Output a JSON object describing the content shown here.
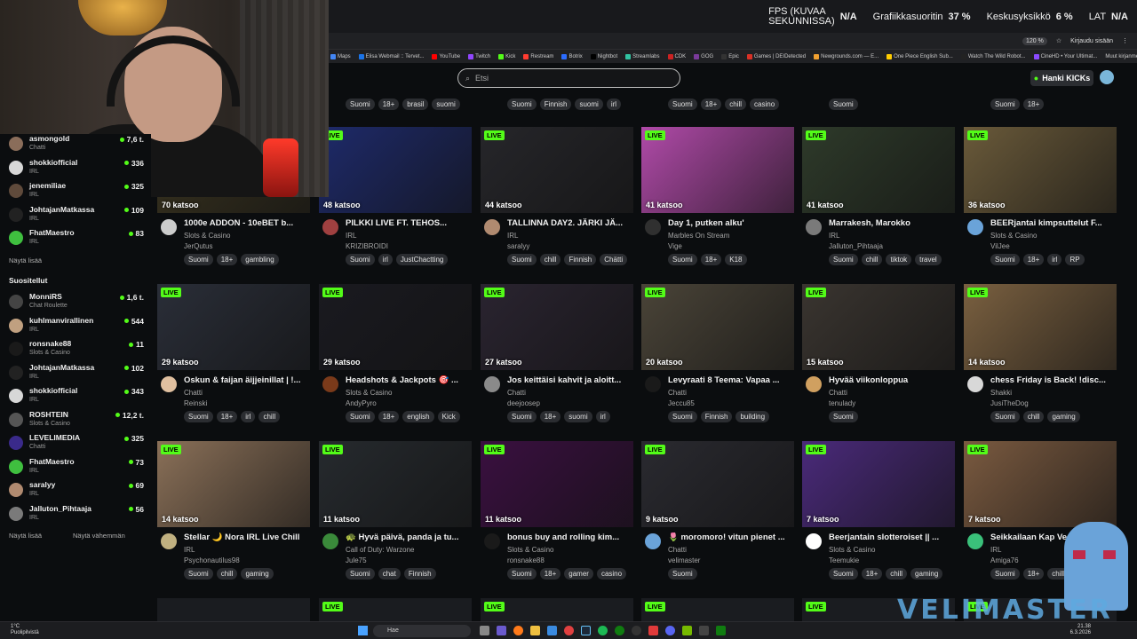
{
  "overlay": {
    "fps_label_line1": "FPS (KUVAA",
    "fps_label_line2": "SEKUNNISSA)",
    "fps_value": "N/A",
    "gpu_label": "Grafiikkasuoritin",
    "gpu_value": "37 %",
    "cpu_label": "Keskusyksikkö",
    "cpu_value": "6 %",
    "lat_label": "LAT",
    "lat_value": "N/A"
  },
  "browser": {
    "zoom": "120 %",
    "signin": "Kirjaudu sisään",
    "bookmarks": [
      "Maps",
      "Elisa Webmail :: Tervet...",
      "YouTube",
      "Twitch",
      "Kick",
      "Restream",
      "Botrix",
      "Nightbot",
      "Streamlabs",
      "CDK",
      "GOG",
      "Epic",
      "Games | DEIDetected",
      "Newgrounds.com — E...",
      "One Piece English Sub...",
      "Watch The Wild Robot...",
      "CineHD • Your Ultimat..."
    ],
    "other_bookmarks": "Muut kirjanmerkit"
  },
  "header": {
    "search_placeholder": "Etsi",
    "kick_button": "Hanki KICKs"
  },
  "sidebar": {
    "following": [
      {
        "name": "asmongold",
        "cat": "Chatti",
        "viewers": "7,6 t.",
        "color": "#8a6d5a"
      },
      {
        "name": "shokkiofficial",
        "cat": "IRL",
        "viewers": "336",
        "color": "#d7d7d7"
      },
      {
        "name": "jenemiliae",
        "cat": "IRL",
        "viewers": "325",
        "color": "#5f4a3b"
      },
      {
        "name": "JohtajanMatkassa",
        "cat": "IRL",
        "viewers": "109",
        "color": "#222222"
      },
      {
        "name": "FhatMaestro",
        "cat": "IRL",
        "viewers": "83",
        "color": "#3fbf3f"
      }
    ],
    "show_more": "Näytä lisää",
    "recommended_title": "Suositellut",
    "recommended": [
      {
        "name": "MonniRS",
        "cat": "Chat Roulette",
        "viewers": "1,6 t.",
        "color": "#444444"
      },
      {
        "name": "kuhlmanvirallinen",
        "cat": "IRL",
        "viewers": "544",
        "color": "#c0a080"
      },
      {
        "name": "ronsnake88",
        "cat": "Slots & Casino",
        "viewers": "11",
        "color": "#1a1a1a"
      },
      {
        "name": "JohtajanMatkassa",
        "cat": "IRL",
        "viewers": "102",
        "color": "#222222"
      },
      {
        "name": "shokkiofficial",
        "cat": "IRL",
        "viewers": "343",
        "color": "#d7d7d7"
      },
      {
        "name": "ROSHTEIN",
        "cat": "Slots & Casino",
        "viewers": "12,2 t.",
        "color": "#555555"
      },
      {
        "name": "LEVELIMEDIA",
        "cat": "Chatti",
        "viewers": "325",
        "color": "#3a2a8a"
      },
      {
        "name": "FhatMaestro",
        "cat": "IRL",
        "viewers": "73",
        "color": "#3fbf3f"
      },
      {
        "name": "saralyy",
        "cat": "IRL",
        "viewers": "69",
        "color": "#b08a70"
      },
      {
        "name": "Jalluton_Pihtaaja",
        "cat": "IRL",
        "viewers": "56",
        "color": "#7a7a7a"
      }
    ],
    "show_more2": "Näytä lisää",
    "show_less": "Näytä vähemmän"
  },
  "top_tags": [
    [
      "Suomi",
      "18+",
      "brasil",
      "suomi"
    ],
    [
      "Suomi",
      "Finnish",
      "suomi",
      "irl"
    ],
    [
      "Suomi",
      "18+",
      "chill",
      "casino"
    ],
    [
      "Suomi"
    ],
    [
      "Suomi",
      "18+"
    ]
  ],
  "live_label": "LIVE",
  "rows": [
    [
      {
        "viewers": "70 katsoo",
        "title": "1000e ADDON - 10eBET b...",
        "cat": "Slots & Casino",
        "user": "JerQutus",
        "tags": [
          "Suomi",
          "18+",
          "gambling"
        ],
        "thumb": "#3a3420",
        "av": "#cccccc",
        "live": false
      },
      {
        "viewers": "48 katsoo",
        "title": "PILKKI LIVE FT. TEHOS...",
        "cat": "IRL",
        "user": "KRIZIBROIDI",
        "tags": [
          "Suomi",
          "irl",
          "JustChactting"
        ],
        "thumb": "#1e2a6a",
        "av": "#a04040",
        "live": true
      },
      {
        "viewers": "44 katsoo",
        "title": "TALLINNA DAY2. JÄRKI JÄ...",
        "cat": "IRL",
        "user": "saralyy",
        "tags": [
          "Suomi",
          "chill",
          "Finnish",
          "Chätti"
        ],
        "thumb": "#26262a",
        "av": "#b08a70",
        "live": true
      },
      {
        "viewers": "41 katsoo",
        "title": "Day 1, putken alku'",
        "cat": "Marbles On Stream",
        "user": "Vige",
        "tags": [
          "Suomi",
          "18+",
          "K18"
        ],
        "thumb": "#b04aa8",
        "av": "#303030",
        "live": true
      },
      {
        "viewers": "41 katsoo",
        "title": "Marrakesh, Marokko",
        "cat": "IRL",
        "user": "Jalluton_Pihtaaja",
        "tags": [
          "Suomi",
          "chill",
          "tiktok",
          "travel"
        ],
        "thumb": "#2e3a2a",
        "av": "#7a7a7a",
        "live": true
      },
      {
        "viewers": "36 katsoo",
        "title": "BEERjantai kimpsuttelut F...",
        "cat": "Slots & Casino",
        "user": "VilJee",
        "tags": [
          "Suomi",
          "18+",
          "irl",
          "RP"
        ],
        "thumb": "#6a5a3a",
        "av": "#6aa3d9",
        "live": true
      }
    ],
    [
      {
        "viewers": "29 katsoo",
        "title": "Oskun & faijan äijjeinillat | !...",
        "cat": "Chatti",
        "user": "Reinski",
        "tags": [
          "Suomi",
          "18+",
          "irl",
          "chill"
        ],
        "thumb": "#2a2e38",
        "av": "#e0c0a0",
        "live": true
      },
      {
        "viewers": "29 katsoo",
        "title": "Headshots & Jackpots 🎯 ...",
        "cat": "Slots & Casino",
        "user": "AndyPyro",
        "tags": [
          "Suomi",
          "18+",
          "english",
          "Kick"
        ],
        "thumb": "#1a1a20",
        "av": "#7a3a1a",
        "live": true
      },
      {
        "viewers": "27 katsoo",
        "title": "Jos keittäisi kahvit ja aloitt...",
        "cat": "Chatti",
        "user": "deejoosep",
        "tags": [
          "Suomi",
          "18+",
          "suomi",
          "irl"
        ],
        "thumb": "#2a2430",
        "av": "#8a8a8a",
        "live": true
      },
      {
        "viewers": "20 katsoo",
        "title": "Levyraati 8 Teema: Vapaa ...",
        "cat": "Chatti",
        "user": "Jeccu85",
        "tags": [
          "Suomi",
          "Finnish",
          "building"
        ],
        "thumb": "#4a4438",
        "av": "#1a1a1a",
        "live": true
      },
      {
        "viewers": "15 katsoo",
        "title": "Hyvää viikonloppua",
        "cat": "Chatti",
        "user": "tenulady",
        "tags": [
          "Suomi"
        ],
        "thumb": "#3a3530",
        "av": "#d0a060",
        "live": true
      },
      {
        "viewers": "14 katsoo",
        "title": "chess Friday is Back! !disc...",
        "cat": "Shakki",
        "user": "JusiTheDog",
        "tags": [
          "Suomi",
          "chill",
          "gaming"
        ],
        "thumb": "#7a6040",
        "av": "#d8d8d8",
        "live": true
      }
    ],
    [
      {
        "viewers": "14 katsoo",
        "title": "Stellar 🌙 Nora IRL Live Chill",
        "cat": "IRL",
        "user": "Psychonautilus98",
        "tags": [
          "Suomi",
          "chill",
          "gaming"
        ],
        "thumb": "#8a7058",
        "av": "#c0b080",
        "live": true
      },
      {
        "viewers": "11 katsoo",
        "title": "🐢 Hyvä päivä, panda ja tu...",
        "cat": "Call of Duty: Warzone",
        "user": "Jule75",
        "tags": [
          "Suomi",
          "chat",
          "Finnish"
        ],
        "thumb": "#262a2e",
        "av": "#3a8a3a",
        "live": true
      },
      {
        "viewers": "11 katsoo",
        "title": "bonus buy and rolling kim...",
        "cat": "Slots & Casino",
        "user": "ronsnake88",
        "tags": [
          "Suomi",
          "18+",
          "gamer",
          "casino"
        ],
        "thumb": "#3a1040",
        "av": "#1a1a1a",
        "live": true
      },
      {
        "viewers": "9 katsoo",
        "title": "🌷 moromoro! vitun pienet ...",
        "cat": "Chatti",
        "user": "velimaster",
        "tags": [
          "Suomi"
        ],
        "thumb": "#2a2a30",
        "av": "#6aa3d9",
        "live": true
      },
      {
        "viewers": "7 katsoo",
        "title": "Beerjantain slotteroiset || ...",
        "cat": "Slots & Casino",
        "user": "Teemukie",
        "tags": [
          "Suomi",
          "18+",
          "chill",
          "gaming"
        ],
        "thumb": "#4a2a7a",
        "av": "#ffffff",
        "live": true
      },
      {
        "viewers": "7 katsoo",
        "title": "Seikkailaan Kap Ve...",
        "cat": "IRL",
        "user": "Amiga76",
        "tags": [
          "Suomi",
          "18+",
          "chill"
        ],
        "thumb": "#7a5a40",
        "av": "#3ac07a",
        "live": true
      }
    ]
  ],
  "taskbar": {
    "weather_temp": "1°C",
    "weather_desc": "Puolipilvistä",
    "search": "Hae",
    "time": "21.38",
    "date": "6.3.2026"
  },
  "watermark": "VELIMASTER"
}
